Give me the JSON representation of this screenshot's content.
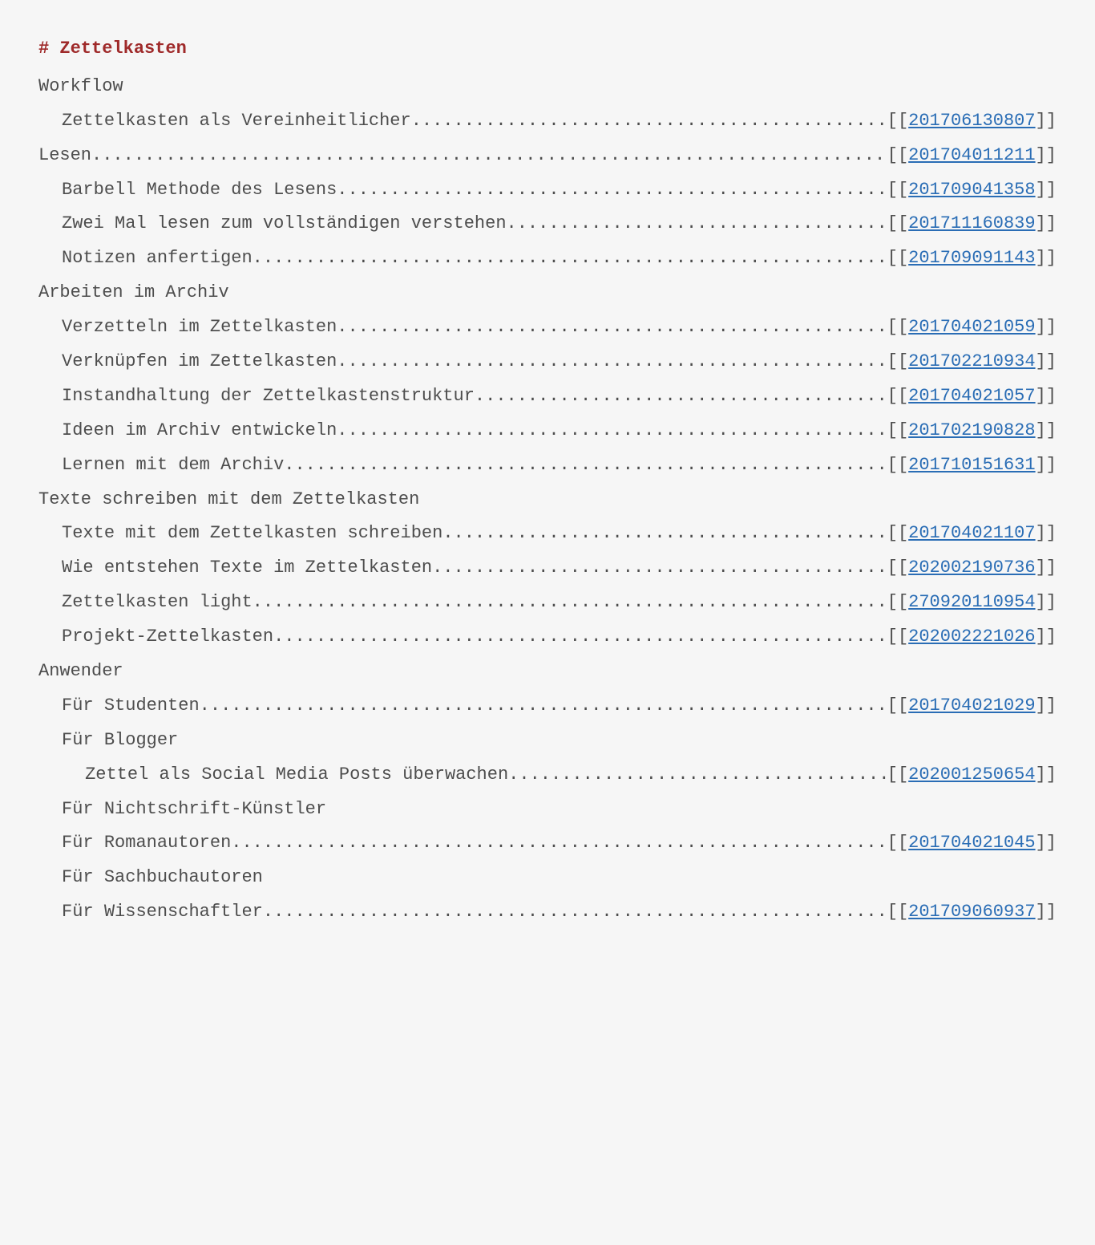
{
  "title": "# Zettelkasten",
  "rows": [
    {
      "indent": 0,
      "label": "Workflow"
    },
    {
      "indent": 1,
      "label": "Zettelkasten als Vereinheitlicher",
      "id": "201706130807"
    },
    {
      "indent": 0,
      "label": "Lesen",
      "id": "201704011211"
    },
    {
      "indent": 1,
      "label": "Barbell Methode des Lesens",
      "id": "201709041358"
    },
    {
      "indent": 1,
      "label": "Zwei Mal lesen zum vollständigen verstehen",
      "id": "201711160839"
    },
    {
      "indent": 1,
      "label": "Notizen anfertigen",
      "id": "201709091143"
    },
    {
      "indent": 0,
      "label": "Arbeiten im Archiv"
    },
    {
      "indent": 1,
      "label": "Verzetteln im Zettelkasten",
      "id": "201704021059"
    },
    {
      "indent": 1,
      "label": "Verknüpfen im Zettelkasten",
      "id": "201702210934"
    },
    {
      "indent": 1,
      "label": "Instandhaltung der Zettelkastenstruktur",
      "id": "201704021057"
    },
    {
      "indent": 1,
      "label": "Ideen im Archiv entwickeln",
      "id": "201702190828"
    },
    {
      "indent": 1,
      "label": "Lernen mit dem Archiv",
      "id": "201710151631"
    },
    {
      "indent": 0,
      "label": "Texte schreiben mit dem Zettelkasten"
    },
    {
      "indent": 1,
      "label": "Texte mit dem Zettelkasten schreiben",
      "id": "201704021107"
    },
    {
      "indent": 1,
      "label": "Wie entstehen Texte im Zettelkasten",
      "id": "202002190736"
    },
    {
      "indent": 1,
      "label": "Zettelkasten light",
      "id": "270920110954"
    },
    {
      "indent": 1,
      "label": "Projekt-Zettelkasten",
      "id": "202002221026"
    },
    {
      "indent": 0,
      "label": "Anwender"
    },
    {
      "indent": 1,
      "label": "Für Studenten",
      "id": "201704021029"
    },
    {
      "indent": 1,
      "label": "Für Blogger"
    },
    {
      "indent": 2,
      "label": "Zettel als Social Media Posts überwachen",
      "id": "202001250654"
    },
    {
      "indent": 1,
      "label": "Für Nichtschrift-Künstler"
    },
    {
      "indent": 1,
      "label": "Für Romanautoren",
      "id": "201704021045"
    },
    {
      "indent": 1,
      "label": "Für Sachbuchautoren"
    },
    {
      "indent": 1,
      "label": "Für Wissenschaftler",
      "id": "201709060937"
    }
  ]
}
